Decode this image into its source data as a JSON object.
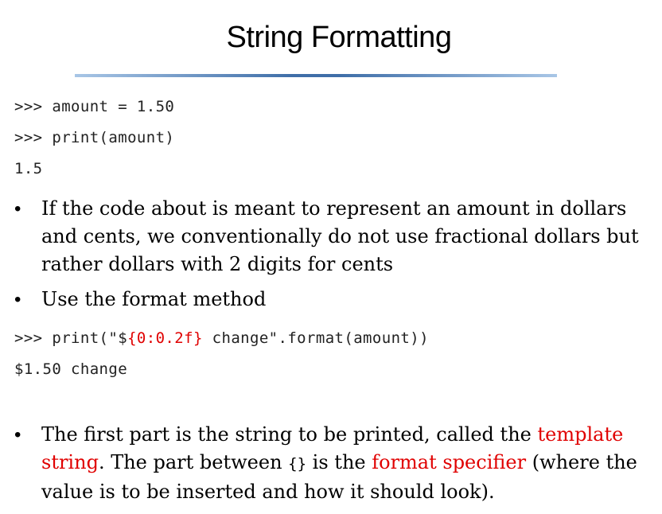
{
  "title": "String Formatting",
  "code_block_1": {
    "line1": ">>> amount = 1.50",
    "line2": ">>> print(amount)",
    "line3": "1.5"
  },
  "bullets": {
    "b1": "If the code about is meant to represent an amount in dollars and cents, we conventionally do not use fractional dollars but rather dollars with 2 digits for cents",
    "b2": "Use the format method",
    "b3": {
      "part1": "The first part is the string to be printed, called the ",
      "term1": "template string",
      "part2": ". The part between ",
      "braces": "{}",
      "part3": " is the ",
      "term2": "format specifier",
      "part4": " (where the value is to be inserted and how it should look)."
    }
  },
  "code_block_2": {
    "line1_prefix": ">>> print(\"$",
    "line1_red": "{0:0.2f}",
    "line1_suffix": " change\".format(amount))",
    "line2": "$1.50 change"
  },
  "colors": {
    "highlight": "#e00000",
    "rule": "#3f6ea8"
  }
}
